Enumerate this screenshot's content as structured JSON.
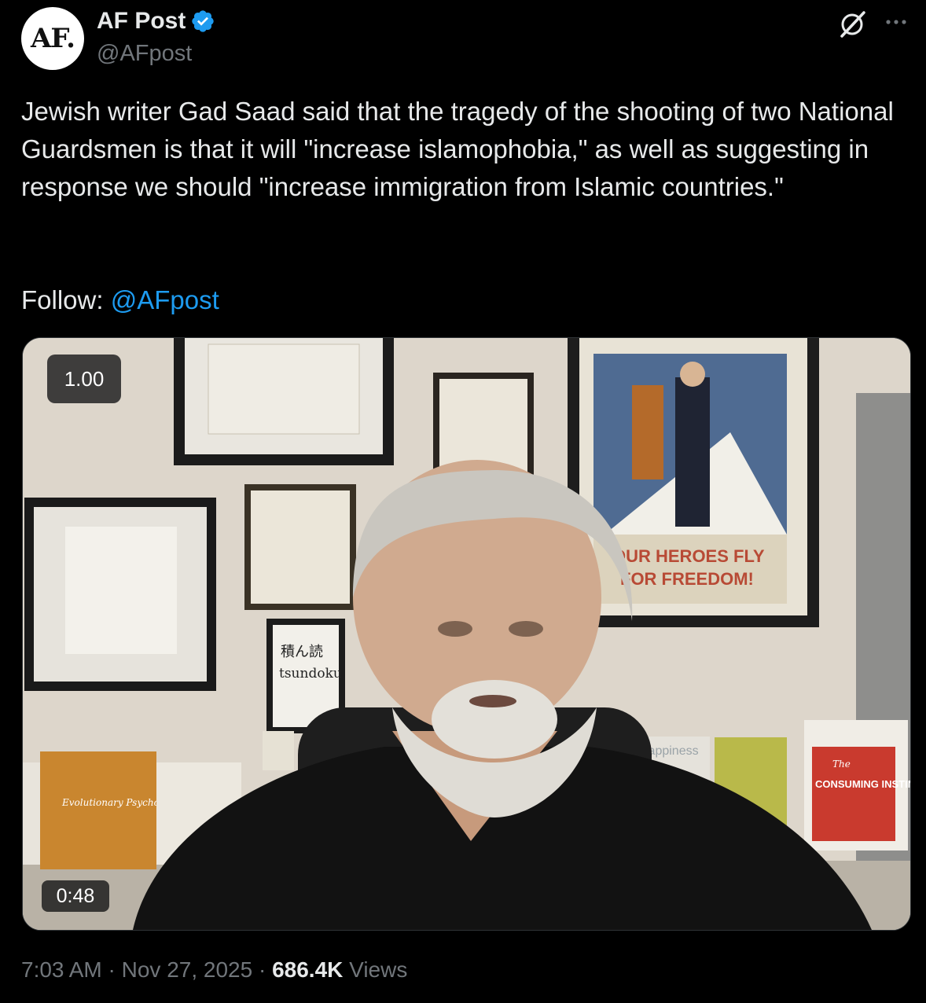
{
  "author": {
    "avatar_text": "AF.",
    "name": "AF Post",
    "handle": "@AFpost",
    "verified": true
  },
  "tweet": {
    "text": "Jewish writer Gad Saad said that the tragedy of the shooting of two National Guardsmen is that it will \"increase islamophobia,\" as well as suggesting in response we should \"increase immigration from Islamic countries.\"",
    "follow_prefix": "Follow: ",
    "follow_mention": "@AFpost"
  },
  "video": {
    "speed": "1.00",
    "duration": "0:48",
    "poster_text_line1": "OUR HEROES FLY",
    "poster_text_line2": "FOR FREEDOM!",
    "sign_kanji": "積ん読",
    "sign_word": "tsundoku",
    "book_left_title": "Evolutionary Psychology in the Business Sciences",
    "book_right_title": "CONSUMING INSTINCT",
    "book_right_the": "The",
    "book_mid_title": "Happiness"
  },
  "meta": {
    "time": "7:03 AM",
    "sep1": " · ",
    "date": "Nov 27, 2025",
    "sep2": " · ",
    "views_count": "686.4K",
    "views_label": " Views"
  },
  "colors": {
    "background": "#000000",
    "text": "#e7e9ea",
    "muted": "#71767b",
    "link": "#1d9bf0",
    "verified": "#1d9bf0"
  },
  "icons": [
    "verified-badge-icon",
    "grok-icon",
    "more-icon"
  ]
}
